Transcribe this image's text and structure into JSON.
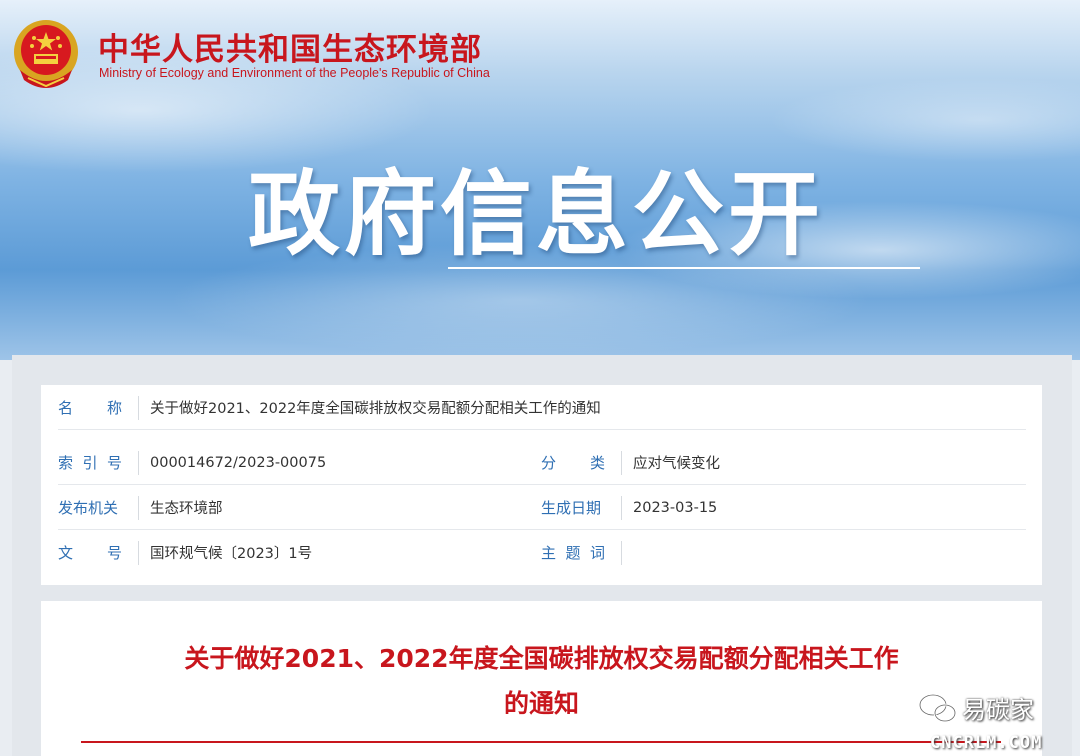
{
  "header": {
    "ministry_cn": "中华人民共和国生态环境部",
    "ministry_en": "Ministry of Ecology and Environment of the People's Republic of China",
    "banner_title": "政府信息公开",
    "emblem_icon": "national-emblem-icon",
    "brand_color": "#c8161d"
  },
  "meta": {
    "name_label": "名称",
    "name_value": "关于做好2021、2022年度全国碳排放权交易配额分配相关工作的通知",
    "index_label": "索引号",
    "index_value": "000014672/2023-00075",
    "category_label": "分类",
    "category_value": "应对气候变化",
    "issuer_label": "发布机关",
    "issuer_value": "生态环境部",
    "date_label": "生成日期",
    "date_value": "2023-03-15",
    "docno_label": "文号",
    "docno_value": "国环规气候〔2023〕1号",
    "keywords_label": "主题词",
    "keywords_value": "",
    "label_color": "#2f6fb3"
  },
  "document": {
    "title_line1": "关于做好2021、2022年度全国碳排放权交易配额分配相关工作",
    "title_line2": "的通知"
  },
  "watermark": {
    "icon": "wechat-icon",
    "name": "易碳家",
    "url": "CNCRLM.COM"
  }
}
